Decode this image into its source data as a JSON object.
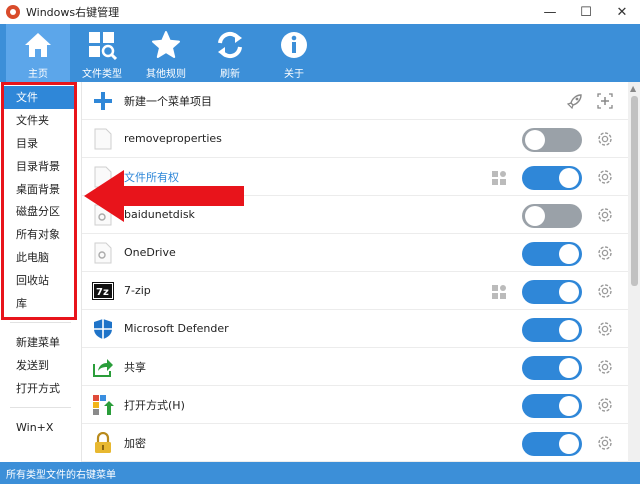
{
  "window": {
    "title": "Windows右键管理",
    "controls": [
      "—",
      "☐",
      "✕"
    ]
  },
  "toolbar": {
    "items": [
      {
        "label": "主页",
        "icon": "home-icon"
      },
      {
        "label": "文件类型",
        "icon": "file-type-icon"
      },
      {
        "label": "其他规则",
        "icon": "star-icon"
      },
      {
        "label": "刷新",
        "icon": "refresh-icon"
      },
      {
        "label": "关于",
        "icon": "info-icon"
      }
    ]
  },
  "sidebar": {
    "group1": [
      "文件",
      "文件夹",
      "目录",
      "目录背景",
      "桌面背景",
      "磁盘分区",
      "所有对象",
      "此电脑",
      "回收站",
      "库"
    ],
    "group2": [
      "新建菜单",
      "发送到",
      "打开方式"
    ],
    "group3": [
      "Win+X"
    ]
  },
  "main": {
    "rows": [
      {
        "label": "新建一个菜单项目",
        "icon": "plus-icon",
        "toggle": null
      },
      {
        "label": "removeproperties",
        "icon": "blank-file-icon",
        "toggle": "off"
      },
      {
        "label": "文件所有权",
        "icon": "blank-file-icon",
        "toggle": "on"
      },
      {
        "label": "baidunetdisk",
        "icon": "gear-file-icon",
        "toggle": "off"
      },
      {
        "label": "OneDrive",
        "icon": "gear-file-icon",
        "toggle": "on"
      },
      {
        "label": "7-zip",
        "icon": "7zip-icon",
        "toggle": "on"
      },
      {
        "label": "Microsoft Defender",
        "icon": "shield-icon",
        "toggle": "on"
      },
      {
        "label": "共享",
        "icon": "share-icon",
        "toggle": "on"
      },
      {
        "label": "打开方式(H)",
        "icon": "open-with-icon",
        "toggle": "on"
      },
      {
        "label": "加密",
        "icon": "lock-icon",
        "toggle": "on"
      }
    ]
  },
  "statusbar": {
    "text": "所有类型文件的右键菜单"
  },
  "colors": {
    "accent": "#2f87d8",
    "toolbar": "#3c8fd8",
    "highlight_box": "#e8141b"
  }
}
